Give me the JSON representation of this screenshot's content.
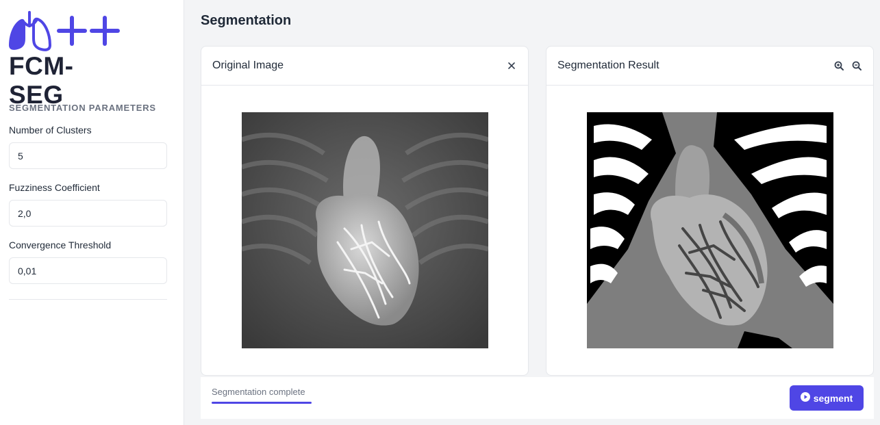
{
  "app": {
    "logo_text": "FCM-SEG",
    "accent_color": "#4f46e5"
  },
  "sidebar": {
    "section_title": "SEGMENTATION PARAMETERS",
    "params": [
      {
        "label": "Number of Clusters",
        "value": "5"
      },
      {
        "label": "Fuzziness Coefficient",
        "value": "2,0"
      },
      {
        "label": "Convergence Threshold",
        "value": "0,01"
      }
    ]
  },
  "main": {
    "title": "Segmentation",
    "panels": [
      {
        "title": "Original Image",
        "icons": [
          "close-icon"
        ]
      },
      {
        "title": "Segmentation Result",
        "icons": [
          "zoom-in-icon",
          "zoom-out-icon"
        ]
      }
    ]
  },
  "footer": {
    "status": "Segmentation complete",
    "progress": 1.0,
    "segment_label": "segment",
    "segment_icon": "play-circle-icon"
  }
}
